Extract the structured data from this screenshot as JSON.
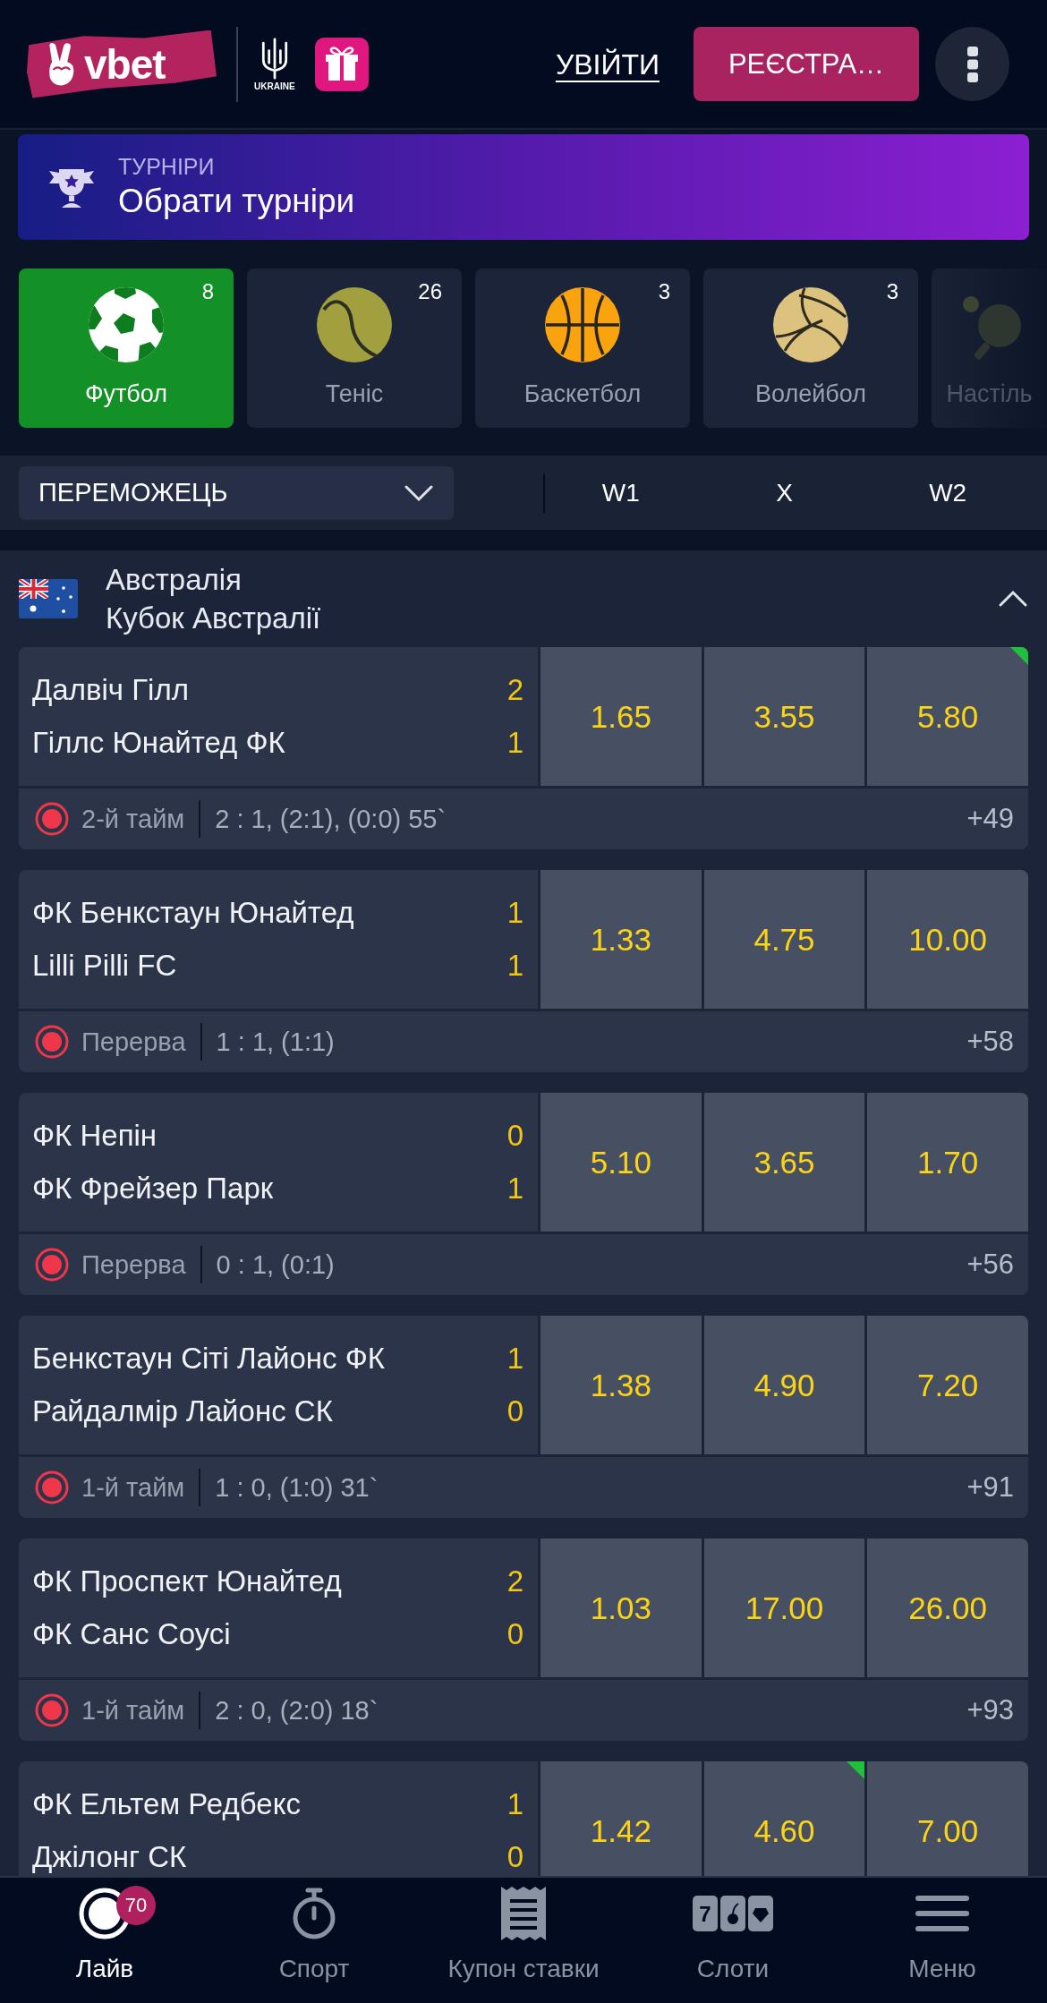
{
  "header": {
    "logo_text": "vbet",
    "emblem_caption": "UKRAINE",
    "login": "УВІЙТИ",
    "register": "РЕЄСТРА…"
  },
  "tournaments": {
    "caption": "ТУРНІРИ",
    "title": "Обрати турніри"
  },
  "sports": [
    {
      "kind": "football",
      "name": "Футбол",
      "count": "8",
      "selected": true
    },
    {
      "kind": "tennis",
      "name": "Теніс",
      "count": "26",
      "selected": false
    },
    {
      "kind": "basketball",
      "name": "Баскетбол",
      "count": "3",
      "selected": false
    },
    {
      "kind": "volleyball",
      "name": "Волейбол",
      "count": "3",
      "selected": false
    },
    {
      "kind": "table-tennis",
      "name": "Настіль",
      "selected": false
    }
  ],
  "market": {
    "label": "ПЕРЕМОЖЕЦЬ",
    "columns": [
      "W1",
      "X",
      "W2"
    ]
  },
  "league": {
    "country": "Австралія",
    "name": "Кубок Австралії",
    "expanded": true,
    "matches": [
      {
        "team1": "Далвіч Гілл",
        "score1": "2",
        "team2": "Гіллс Юнайтед ФК",
        "score2": "1",
        "odds": [
          {
            "value": "1.65",
            "rising": false
          },
          {
            "value": "3.55",
            "rising": false
          },
          {
            "value": "5.80",
            "rising": true
          }
        ],
        "period": "2-й тайм",
        "score_detail": "2 : 1, (2:1), (0:0) 55`",
        "more": "+49"
      },
      {
        "team1": "ФК Бенкстаун Юнайтед",
        "score1": "1",
        "team2": "Lilli Pilli FC",
        "score2": "1",
        "odds": [
          {
            "value": "1.33",
            "rising": false
          },
          {
            "value": "4.75",
            "rising": false
          },
          {
            "value": "10.00",
            "rising": false
          }
        ],
        "period": "Перерва",
        "score_detail": "1 : 1, (1:1)",
        "more": "+58"
      },
      {
        "team1": "ФК Непін",
        "score1": "0",
        "team2": "ФК Фрейзер Парк",
        "score2": "1",
        "odds": [
          {
            "value": "5.10",
            "rising": false
          },
          {
            "value": "3.65",
            "rising": false
          },
          {
            "value": "1.70",
            "rising": false
          }
        ],
        "period": "Перерва",
        "score_detail": "0 : 1, (0:1)",
        "more": "+56"
      },
      {
        "team1": "Бенкстаун Сіті Лайонс ФК",
        "score1": "1",
        "team2": "Райдалмір Лайонс СК",
        "score2": "0",
        "odds": [
          {
            "value": "1.38",
            "rising": false
          },
          {
            "value": "4.90",
            "rising": false
          },
          {
            "value": "7.20",
            "rising": false
          }
        ],
        "period": "1-й тайм",
        "score_detail": "1 : 0, (1:0) 31`",
        "more": "+91"
      },
      {
        "team1": "ФК Проспект Юнайтед",
        "score1": "2",
        "team2": "ФК Санс Соусі",
        "score2": "0",
        "odds": [
          {
            "value": "1.03",
            "rising": false
          },
          {
            "value": "17.00",
            "rising": false
          },
          {
            "value": "26.00",
            "rising": false
          }
        ],
        "period": "1-й тайм",
        "score_detail": "2 : 0, (2:0) 18`",
        "more": "+93"
      },
      {
        "team1": "ФК Ельтем Редбекс",
        "score1": "1",
        "team2": "Джілонг СК",
        "score2": "0",
        "odds": [
          {
            "value": "1.42",
            "rising": false
          },
          {
            "value": "4.60",
            "rising": true
          },
          {
            "value": "7.00",
            "rising": false
          }
        ]
      }
    ]
  },
  "bottom_nav": [
    {
      "kind": "live",
      "label": "Лайв",
      "selected": true,
      "badge": "70"
    },
    {
      "kind": "sport",
      "label": "Спорт",
      "selected": false
    },
    {
      "kind": "coupon",
      "label": "Купон ставки",
      "selected": false
    },
    {
      "kind": "slots",
      "label": "Слоти",
      "selected": false,
      "reel_symbol": "7"
    },
    {
      "kind": "menu",
      "label": "Меню",
      "selected": false
    }
  ]
}
